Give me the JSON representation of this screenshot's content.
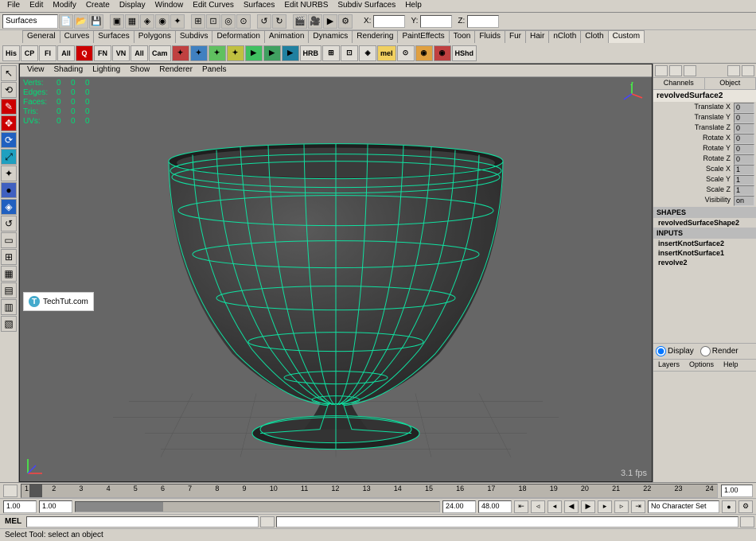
{
  "menu": [
    "File",
    "Edit",
    "Modify",
    "Create",
    "Display",
    "Window",
    "Edit Curves",
    "Surfaces",
    "Edit NURBS",
    "Subdiv Surfaces",
    "Help"
  ],
  "module_selector": "Surfaces",
  "coord_labels": {
    "x": "X:",
    "y": "Y:",
    "z": "Z:"
  },
  "shelf_tabs": [
    "General",
    "Curves",
    "Surfaces",
    "Polygons",
    "Subdivs",
    "Deformation",
    "Animation",
    "Dynamics",
    "Rendering",
    "PaintEffects",
    "Toon",
    "Fluids",
    "Fur",
    "Hair",
    "nCloth",
    "Cloth",
    "Custom"
  ],
  "shelf_active": "Custom",
  "shelf_buttons": [
    "His",
    "CP",
    "FI",
    "All",
    "Q",
    "FN",
    "VN",
    "All",
    "Cam",
    "",
    "",
    "",
    "",
    "",
    "",
    "",
    "HRB",
    "",
    "",
    "",
    "mel",
    "",
    "",
    "",
    "HShd"
  ],
  "panel_menu": [
    "View",
    "Shading",
    "Lighting",
    "Show",
    "Renderer",
    "Panels"
  ],
  "hud": {
    "rows": [
      {
        "label": "Verts:",
        "a": "0",
        "b": "0",
        "c": "0"
      },
      {
        "label": "Edges:",
        "a": "0",
        "b": "0",
        "c": "0"
      },
      {
        "label": "Faces:",
        "a": "0",
        "b": "0",
        "c": "0"
      },
      {
        "label": "Tris:",
        "a": "0",
        "b": "0",
        "c": "0"
      },
      {
        "label": "UVs:",
        "a": "0",
        "b": "0",
        "c": "0"
      }
    ],
    "fps": "3.1 fps"
  },
  "watermark": "TechTut.com",
  "channel_box": {
    "tabs": [
      "Channels",
      "Object"
    ],
    "object": "revolvedSurface2",
    "attrs": [
      {
        "n": "Translate X",
        "v": "0"
      },
      {
        "n": "Translate Y",
        "v": "0"
      },
      {
        "n": "Translate Z",
        "v": "0"
      },
      {
        "n": "Rotate X",
        "v": "0"
      },
      {
        "n": "Rotate Y",
        "v": "0"
      },
      {
        "n": "Rotate Z",
        "v": "0"
      },
      {
        "n": "Scale X",
        "v": "1"
      },
      {
        "n": "Scale Y",
        "v": "1"
      },
      {
        "n": "Scale Z",
        "v": "1"
      },
      {
        "n": "Visibility",
        "v": "on"
      }
    ],
    "shapes_header": "SHAPES",
    "shape": "revolvedSurfaceShape2",
    "inputs_header": "INPUTS",
    "inputs": [
      "insertKnotSurface2",
      "insertKnotSurface1",
      "revolve2"
    ],
    "display_label": "Display",
    "render_label": "Render",
    "layers_menu": [
      "Layers",
      "Options",
      "Help"
    ]
  },
  "timeline": {
    "ticks": [
      "1",
      "2",
      "3",
      "4",
      "5",
      "6",
      "7",
      "8",
      "9",
      "10",
      "11",
      "12",
      "13",
      "14",
      "15",
      "16",
      "17",
      "18",
      "19",
      "20",
      "21",
      "22",
      "23",
      "24"
    ],
    "current_frame_field": "1.00"
  },
  "range": {
    "start": "1.00",
    "range_start": "1.00",
    "end": "24.00",
    "range_end": "24.00",
    "total": "48.00",
    "charset": "No Character Set"
  },
  "cmd_label": "MEL",
  "status_text": "Select Tool: select an object"
}
